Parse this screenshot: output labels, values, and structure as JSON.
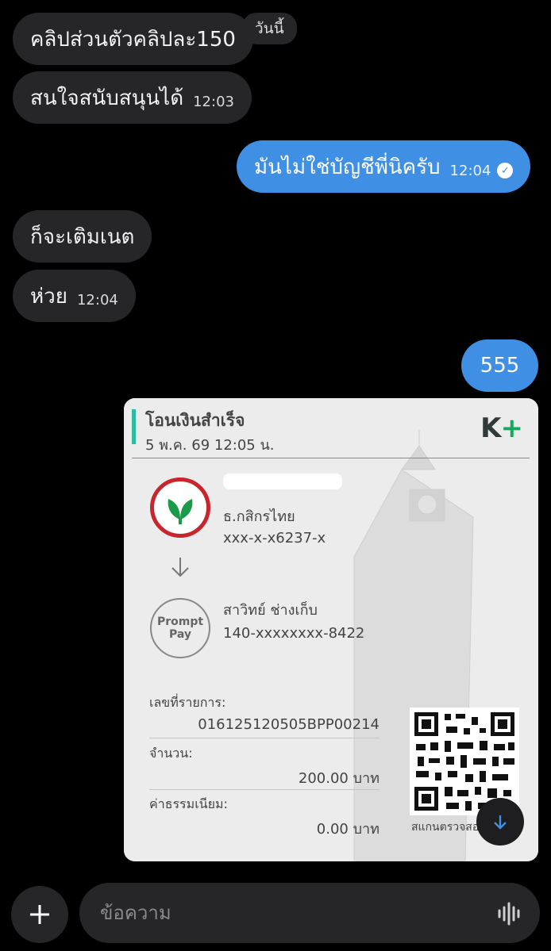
{
  "date_chip": "วันนี้",
  "messages": [
    {
      "text": "คลิปส่วนตัวคลิปละ150",
      "time": ""
    },
    {
      "text": "สนใจสนับสนุนได้",
      "time": "12:03"
    },
    {
      "text": "มันไม่ใช่บัญชีพี่นิครับ",
      "time": "12:04"
    },
    {
      "text": "ก็จะเติมเนต",
      "time": ""
    },
    {
      "text": "ห่วย",
      "time": "12:04"
    },
    {
      "text": "555",
      "time": ""
    }
  ],
  "slip": {
    "title": "โอนเงินสำเร็จ",
    "datetime": "5 พ.ค. 69  12:05 น.",
    "brand_k": "K",
    "brand_plus": "+",
    "from_bank": "ธ.กสิกรไทย",
    "from_account": "xxx-x-x6237-x",
    "to_name": "สาวิทย์ ช่างเก็บ",
    "to_account": "140-xxxxxxxx-8422",
    "promptpay_line1": "Prompt",
    "promptpay_line2": "Pay",
    "ref_label": "เลขที่รายการ:",
    "ref_value": "016125120505BPP00214",
    "amount_label": "จำนวน:",
    "amount_value": "200.00 บาท",
    "fee_label": "ค่าธรรมเนียม:",
    "fee_value": "0.00 บาท",
    "qr_caption": "สแกนตรวจสอบ"
  },
  "composer": {
    "placeholder": "ข้อความ"
  },
  "colors": {
    "outgoing": "#3f8fe4",
    "incoming": "#262628",
    "accent_green": "#12a860",
    "kbank_red": "#c8262c"
  },
  "icons": [
    "check-icon",
    "arrow-down-icon",
    "plus-icon",
    "voice-icon",
    "kbank-logo",
    "promptpay-logo",
    "qr-code"
  ]
}
